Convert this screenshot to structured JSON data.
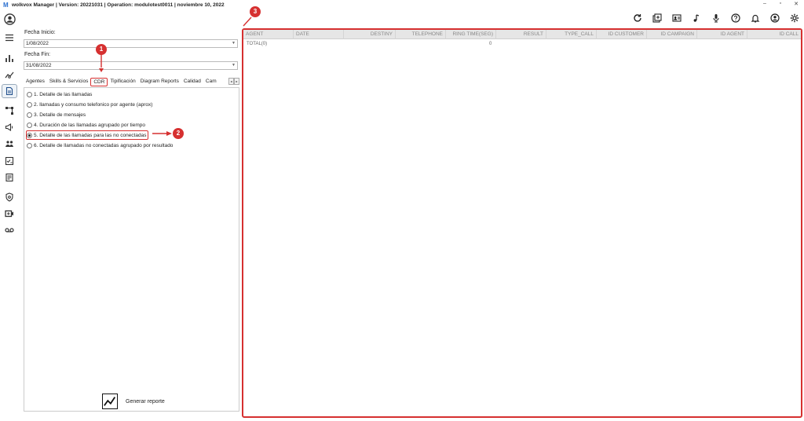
{
  "window": {
    "title": "wolkvox Manager  | Version: 20221031  |  Operation: modulotest0011  |  noviembre 10, 2022",
    "controls": [
      "–",
      "▫",
      "✕"
    ]
  },
  "filters": {
    "start_label": "Fecha Inicio:",
    "start_value": "1/08/2022",
    "end_label": "Fecha Fin:",
    "end_value": "31/08/2022"
  },
  "tabs": [
    "Agentes",
    "Skills & Servicios",
    "CDR",
    "Tipificación",
    "Diagram Reports",
    "Calidad",
    "Cam"
  ],
  "tab_nav": [
    "◂",
    "▸"
  ],
  "options": [
    "1. Detalle de las llamadas",
    "2. llamadas y consumo telefonico por agente (aprox)",
    "3. Detalle de mensajes",
    "4. Duración de las llamadas agrupado por tiempo",
    "5. Detalle de las llamadas para las no conectadas",
    "6. Detalle de llamadas no conectadas agrupado por resultado"
  ],
  "generate_label": "Generar reporte",
  "grid": {
    "columns": [
      "AGENT",
      "DATE",
      "DESTINY",
      "TELEPHONE",
      "RING TIME(SEG)",
      "RESULT",
      "TYPE_CALL",
      "ID CUSTOMER",
      "ID CAMPAIGN",
      "ID AGENT",
      "ID CALL"
    ],
    "total_label": "TOTAL(0)",
    "total_value": "0"
  },
  "callouts": [
    "1",
    "2",
    "3"
  ],
  "colors": {
    "accent": "#d63030",
    "rail_active": "#eef3f8"
  }
}
